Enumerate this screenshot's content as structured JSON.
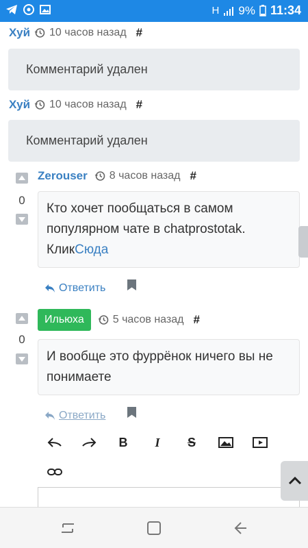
{
  "status_bar": {
    "battery": "9%",
    "time": "11:34",
    "network": "H",
    "icons": [
      "telegram-icon",
      "chrome-icon",
      "gallery-icon",
      "signal-icon",
      "battery-icon"
    ]
  },
  "comments": [
    {
      "author": "Хуй",
      "time": "10 часов назад",
      "hash": "#",
      "text": "Комментарий удален"
    },
    {
      "author": "Хуй",
      "time": "10 часов назад",
      "hash": "#",
      "text": "Комментарий удален"
    },
    {
      "author": "Zerouser",
      "time": "8 часов назад",
      "hash": "#",
      "score": "0",
      "text_line1": "Кто хочет пообщаться в самом",
      "text_line2": "популярном чате в chatprostotak.",
      "text_line3": "Клик",
      "link": "Сюда",
      "reply_label": "Ответить"
    },
    {
      "author": "Ильюха",
      "time": "5 часов назад",
      "hash": "#",
      "score": "0",
      "text_line1": "И вообще это фуррёнок ничего вы не",
      "text_line2": "понимаете",
      "reply_label": "Ответить"
    }
  ],
  "editor_toolbar": {
    "bold": "B",
    "italic": "I",
    "strike": "S",
    "icons": [
      "undo-icon",
      "redo-icon",
      "bold-icon",
      "italic-icon",
      "strikethrough-icon",
      "image-icon",
      "video-icon",
      "link-icon"
    ]
  },
  "colors": {
    "status_bar": "#1e88e5",
    "author": "#3a80c2",
    "badge": "#2fb85a",
    "deleted_bg": "#e9ecef"
  }
}
